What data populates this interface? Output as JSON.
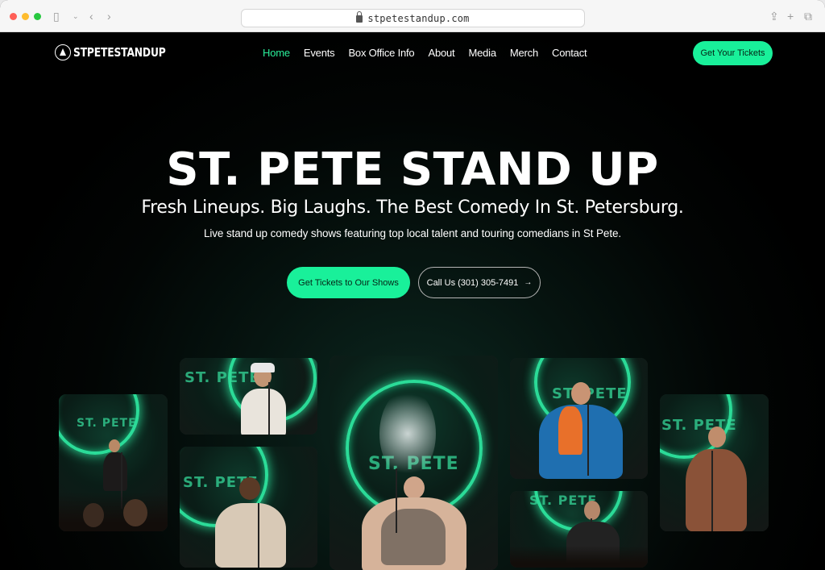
{
  "browser": {
    "url": "stpetestandup.com"
  },
  "header": {
    "logo_text": "STPETESTANDUP",
    "nav": [
      {
        "label": "Home",
        "active": true
      },
      {
        "label": "Events"
      },
      {
        "label": "Box Office Info"
      },
      {
        "label": "About"
      },
      {
        "label": "Media"
      },
      {
        "label": "Merch"
      },
      {
        "label": "Contact"
      }
    ],
    "cta_label": "Get Your Tickets"
  },
  "hero": {
    "title": "ST. PETE STAND UP",
    "subtitle": "Fresh Lineups. Big Laughs. The Best Comedy In St. Petersburg.",
    "description": "Live stand up comedy shows featuring top local talent and touring comedians in St Pete.",
    "primary_button": "Get Tickets to Our Shows",
    "secondary_button": "Call Us (301) 305-7491",
    "secondary_arrow": "→"
  },
  "gallery": {
    "sign_text": "ST. PETE"
  },
  "colors": {
    "accent": "#19f09a",
    "background": "#000000"
  }
}
